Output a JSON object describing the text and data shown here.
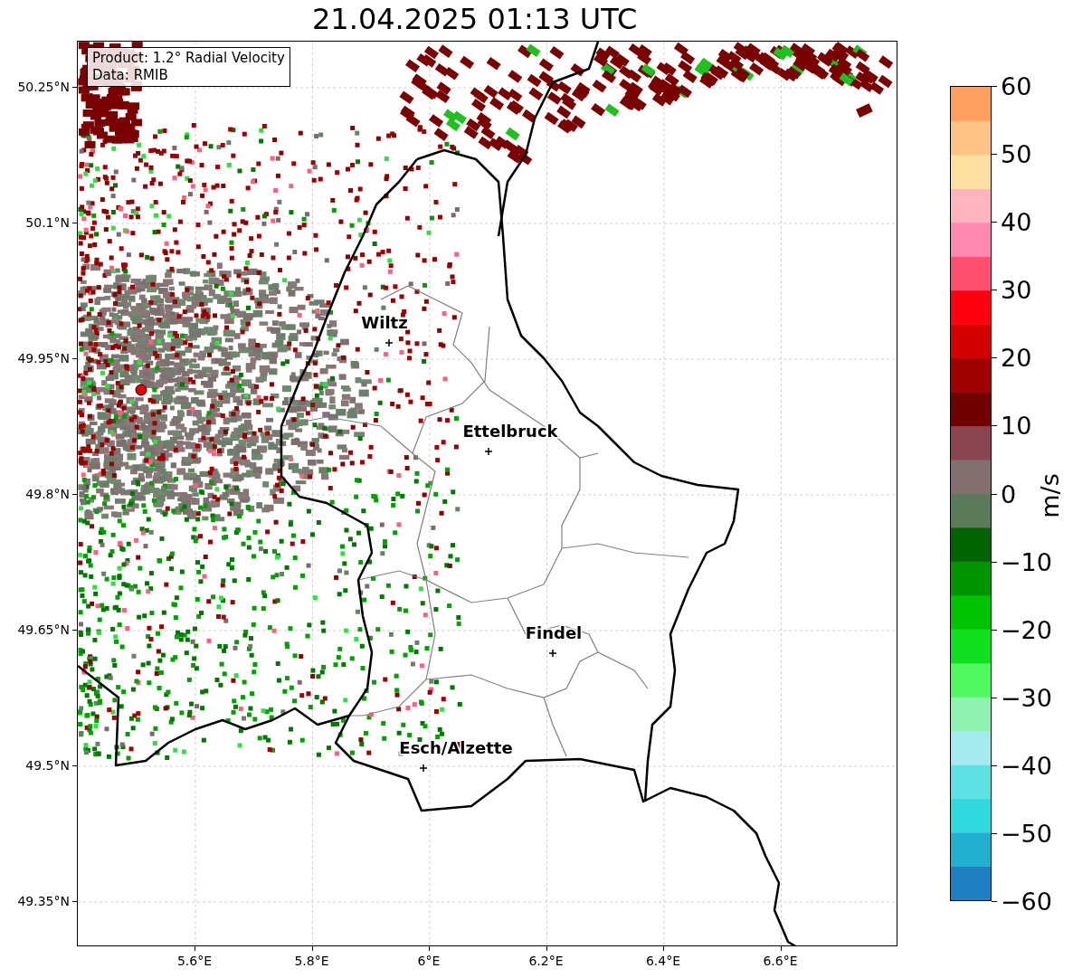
{
  "title": "21.04.2025 01:13 UTC",
  "legend": {
    "lines": [
      "Product: 1.2° Radial Velocity",
      "Data: RMIB"
    ]
  },
  "map": {
    "xticks": [
      "5.6°E",
      "5.8°E",
      "6°E",
      "6.2°E",
      "6.4°E",
      "6.6°E"
    ],
    "yticks": [
      "50.25°N",
      "50.1°N",
      "49.95°N",
      "49.8°N",
      "49.65°N",
      "49.5°N",
      "49.35°N"
    ],
    "cities": [
      {
        "name": "Wiltz"
      },
      {
        "name": "Ettelbruck"
      },
      {
        "name": "Findel"
      },
      {
        "name": "Esch/Alzette"
      }
    ]
  },
  "colorbar": {
    "ticks": [
      "60",
      "50",
      "40",
      "30",
      "20",
      "10",
      "0",
      "−10",
      "−20",
      "−30",
      "−40",
      "−50",
      "−60"
    ],
    "label": "m/s"
  }
}
